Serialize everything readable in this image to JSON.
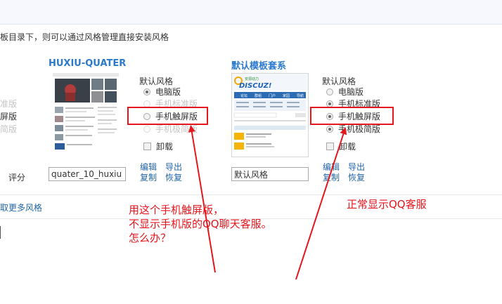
{
  "notice": "板目录下，则可以通过风格管理直接安装风格",
  "left_partial": {
    "options": [
      "准版",
      "屏版",
      "简版"
    ],
    "score_label": "评分",
    "more_styles_link": "取更多风格"
  },
  "theme1": {
    "name": "HUXIU-QUATER",
    "default_style_label": "默认风格",
    "options": [
      "电脑版",
      "手机标准版",
      "手机触屏版",
      "手机极简版"
    ],
    "uninstall_label": "卸载",
    "input_value": "quater_10_huxiu",
    "links": [
      "编辑",
      "导出",
      "复制",
      "恢复"
    ]
  },
  "theme2": {
    "name": "默认模板套系",
    "default_style_label": "默认风格",
    "options": [
      "电脑版",
      "手机标准版",
      "手机触屏版",
      "手机极简版"
    ],
    "uninstall_label": "卸载",
    "input_value": "默认风格",
    "links": [
      "编辑",
      "导出",
      "复制",
      "恢复"
    ],
    "preview": {
      "logo_top": "安源动力",
      "logo_main": "DISCUZ!",
      "nav": [
        "论坛",
        "群组",
        "门户",
        "家园",
        "导航"
      ]
    }
  },
  "annotations": {
    "left_lines": [
      "用这个手机触屏版，",
      "不显示手机版的QQ聊天客服。",
      "怎么办？"
    ],
    "right": "正常显示QQ客服"
  },
  "colors": {
    "annotation_red": "#e5161d",
    "link_blue": "#2366a8",
    "title_blue": "#2b7acd"
  }
}
